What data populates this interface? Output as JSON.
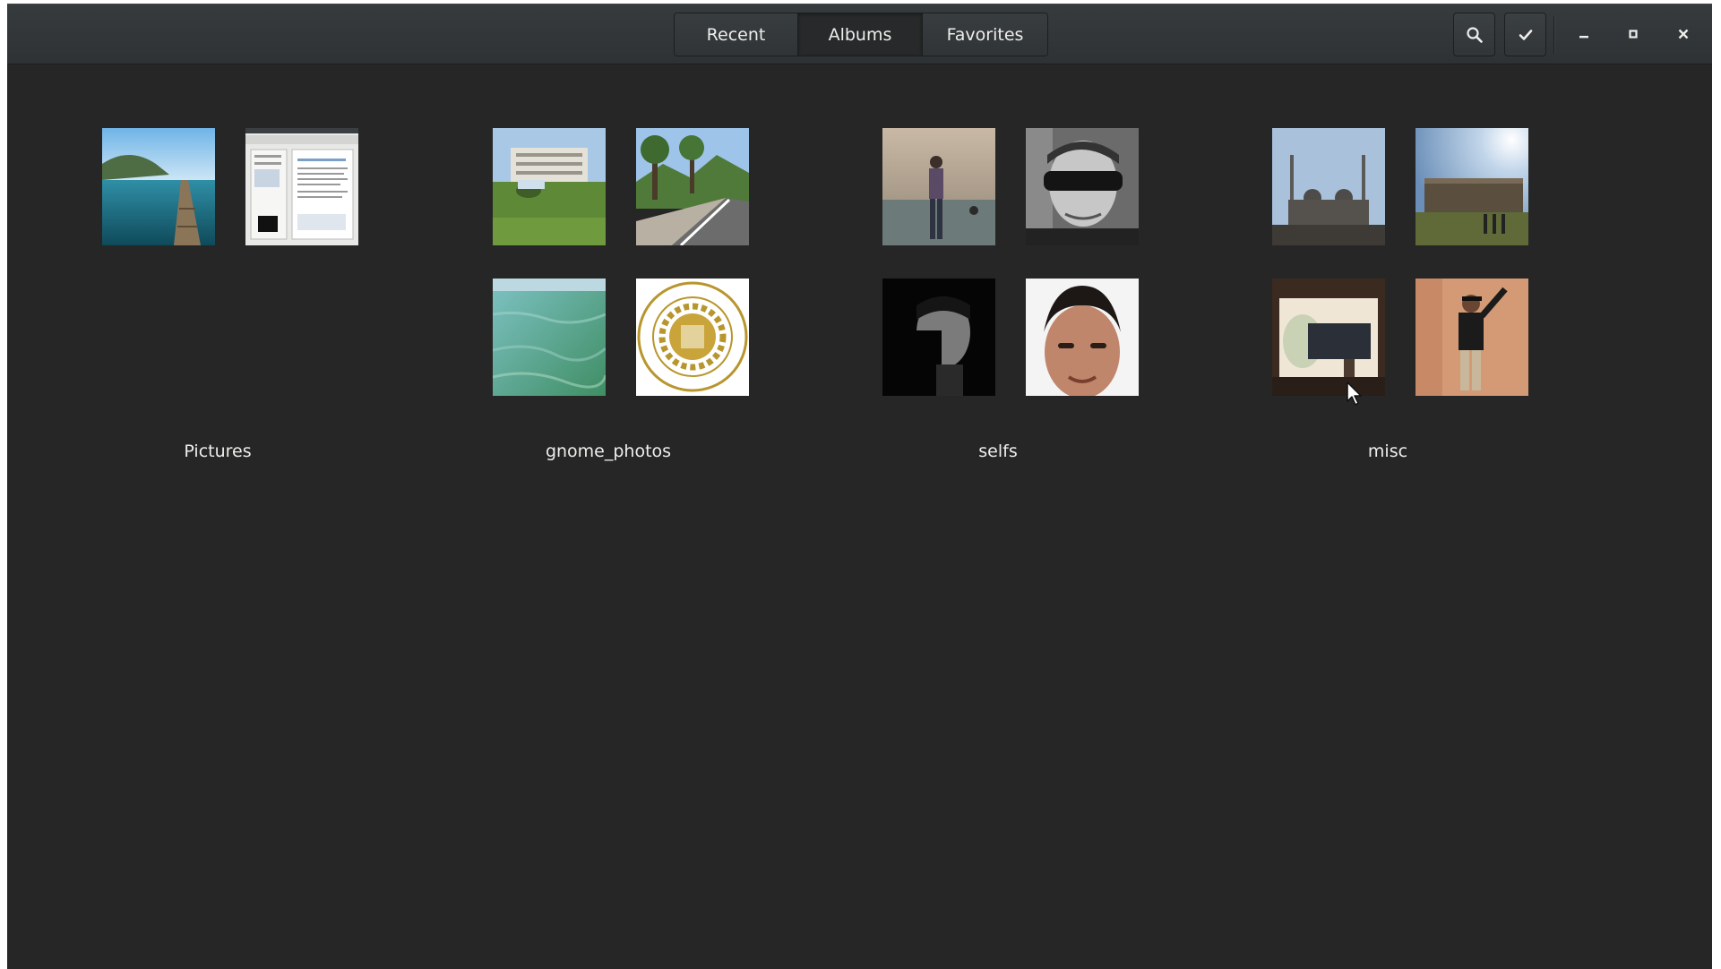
{
  "header": {
    "tabs": [
      {
        "label": "Recent"
      },
      {
        "label": "Albums",
        "active": true
      },
      {
        "label": "Favorites"
      }
    ],
    "buttons": {
      "search": "search-icon",
      "select": "checkmark-icon",
      "minimize": "minimize-icon",
      "maximize": "maximize-icon",
      "close": "close-icon"
    }
  },
  "albums": [
    {
      "title": "Pictures",
      "photo_count": 2
    },
    {
      "title": "gnome_photos",
      "photo_count": 4
    },
    {
      "title": "selfs",
      "photo_count": 4
    },
    {
      "title": "misc",
      "photo_count": 4
    }
  ],
  "colors": {
    "window_bg": "#262626",
    "headerbar": "#33373a",
    "text": "#eeeeec"
  }
}
